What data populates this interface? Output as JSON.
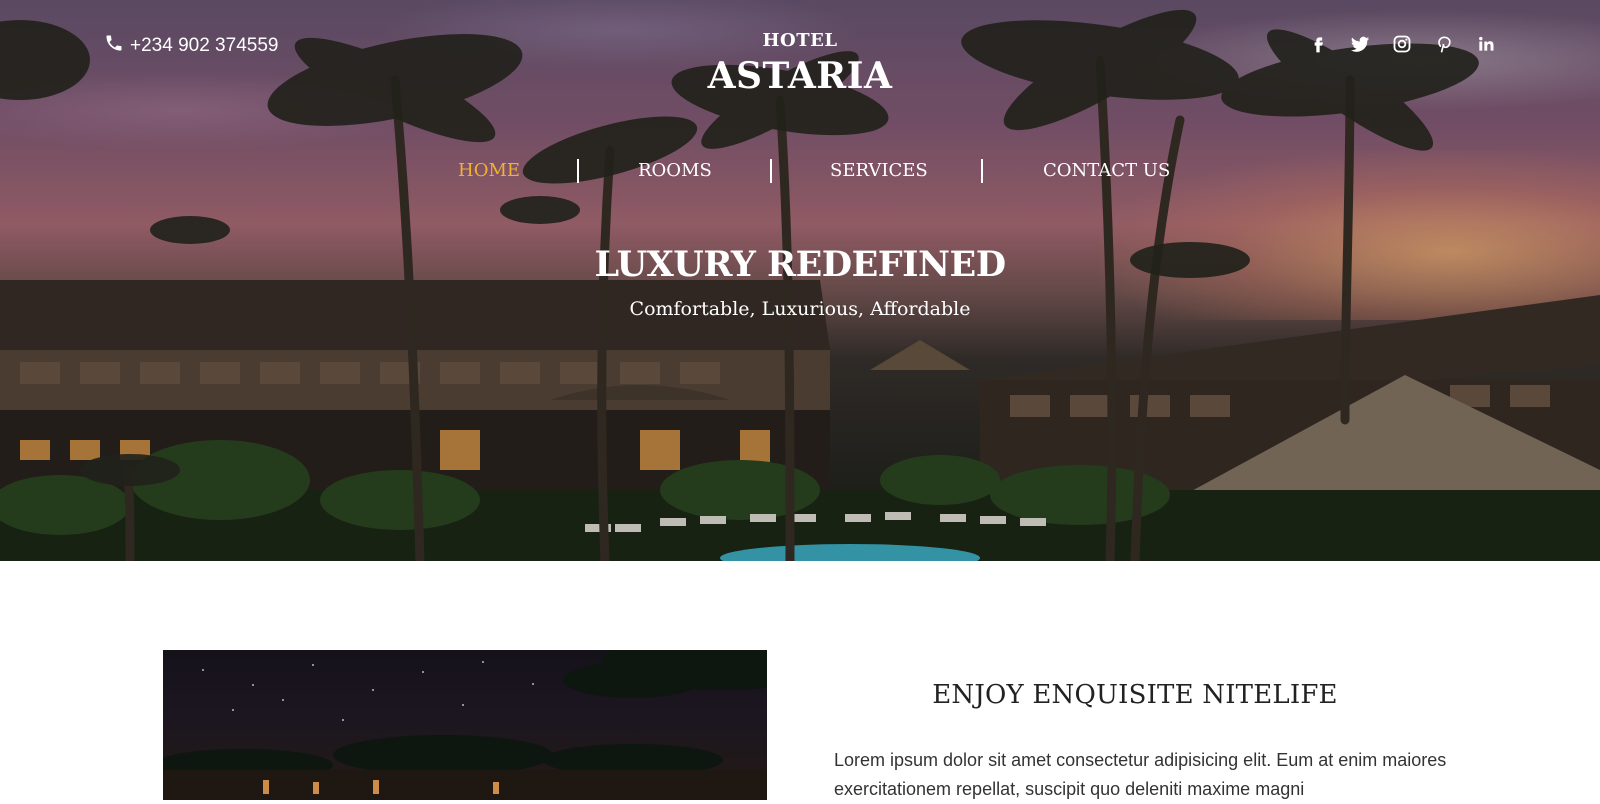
{
  "header": {
    "phone": "+234 902 374559",
    "brand_small": "HOTEL",
    "brand_big": "ASTARIA",
    "social": [
      "facebook-icon",
      "twitter-icon",
      "instagram-icon",
      "pinterest-icon",
      "linkedin-icon"
    ]
  },
  "nav": {
    "items": [
      {
        "label": "HOME",
        "active": true
      },
      {
        "label": "ROOMS",
        "active": false
      },
      {
        "label": "SERVICES",
        "active": false
      },
      {
        "label": "CONTACT US",
        "active": false
      }
    ]
  },
  "hero": {
    "title": "LUXURY REDEFINED",
    "subtitle": "Comfortable, Luxurious, Affordable"
  },
  "feature": {
    "title": "ENJOY ENQUISITE NITELIFE",
    "body": "Lorem ipsum dolor sit amet consectetur adipisicing elit. Eum at enim maiores exercitationem repellat, suscipit quo deleniti maxime magni"
  },
  "colors": {
    "accent": "#f2b134",
    "text": "#222222"
  }
}
